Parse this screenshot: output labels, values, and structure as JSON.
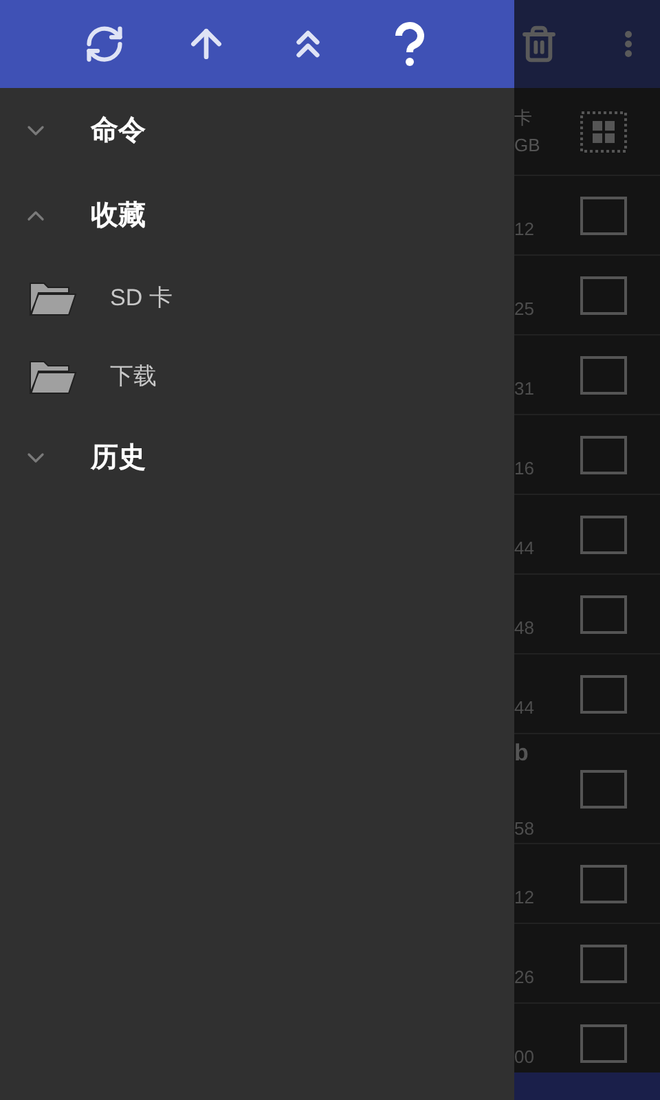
{
  "drawer": {
    "sections": [
      {
        "label": "命令",
        "expanded": false
      },
      {
        "label": "收藏",
        "expanded": true,
        "items": [
          {
            "label": "SD 卡"
          },
          {
            "label": "下载"
          }
        ]
      },
      {
        "label": "历史",
        "expanded": false
      }
    ]
  },
  "background": {
    "header": {
      "line_1": "卡",
      "line_2": "GB"
    },
    "rows": [
      {
        "detail": "12",
        "checked": false
      },
      {
        "detail": "25",
        "checked": false
      },
      {
        "detail": "31",
        "checked": false
      },
      {
        "detail": "16",
        "checked": false
      },
      {
        "detail": "44",
        "checked": false
      },
      {
        "detail": "48",
        "checked": false
      },
      {
        "detail": "44",
        "checked": false
      },
      {
        "title": "b",
        "detail": "58",
        "checked": false
      },
      {
        "detail": "12",
        "checked": false
      },
      {
        "detail": "26",
        "checked": false
      },
      {
        "detail": "00",
        "checked": false
      }
    ]
  }
}
